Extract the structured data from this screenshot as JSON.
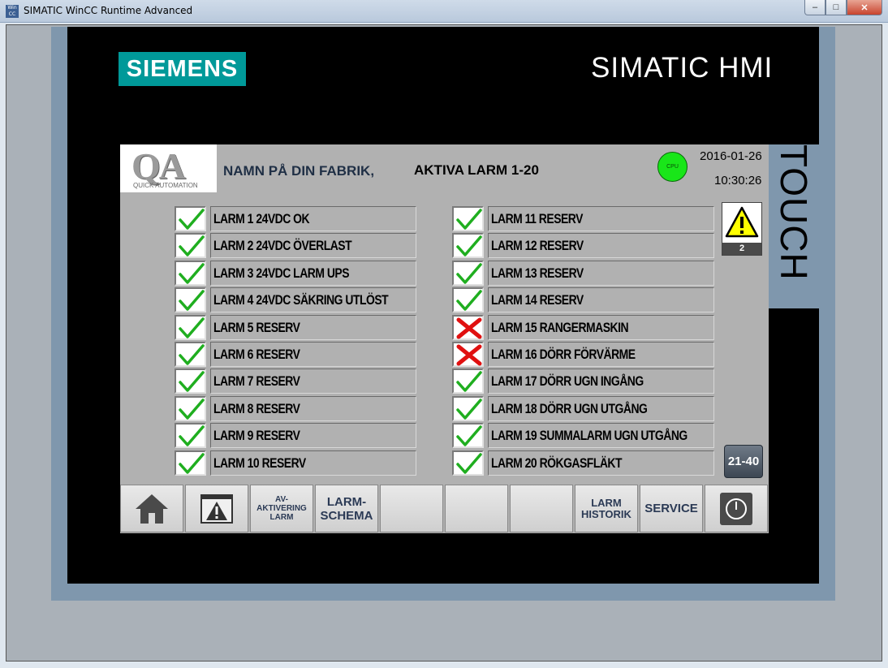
{
  "window": {
    "title": "SIMATIC WinCC Runtime Advanced",
    "icon_text": "Win CC",
    "minimize": "–",
    "maximize": "□",
    "close": "✕"
  },
  "panel": {
    "brand": "SIEMENS",
    "product": "SIMATIC HMI",
    "side_label": "TOUCH"
  },
  "header": {
    "logo_letters": "QA",
    "logo_sub": "QUICK AUTOMATION",
    "factory": "NAMN PÅ DIN FABRIK,",
    "title": "AKTIVA LARM 1-20",
    "cpu_label": "CPU",
    "date": "2016-01-26",
    "time": "10:30:26"
  },
  "alarms_left": [
    {
      "label": "LARM 1 24VDC OK",
      "ok": true
    },
    {
      "label": "LARM 2 24VDC ÖVERLAST",
      "ok": true
    },
    {
      "label": "LARM 3 24VDC LARM UPS",
      "ok": true
    },
    {
      "label": "LARM 4 24VDC SÄKRING UTLÖST",
      "ok": true
    },
    {
      "label": "LARM 5 RESERV",
      "ok": true
    },
    {
      "label": "LARM 6 RESERV",
      "ok": true
    },
    {
      "label": "LARM 7 RESERV",
      "ok": true
    },
    {
      "label": "LARM 8 RESERV",
      "ok": true
    },
    {
      "label": "LARM 9 RESERV",
      "ok": true
    },
    {
      "label": "LARM 10 RESERV",
      "ok": true
    }
  ],
  "alarms_right": [
    {
      "label": "LARM 11 RESERV",
      "ok": true
    },
    {
      "label": "LARM 12 RESERV",
      "ok": true
    },
    {
      "label": "LARM 13 RESERV",
      "ok": true
    },
    {
      "label": "LARM 14 RESERV",
      "ok": true
    },
    {
      "label": "LARM 15 RANGERMASKIN",
      "ok": false
    },
    {
      "label": "LARM 16 DÖRR FÖRVÄRME",
      "ok": false
    },
    {
      "label": "LARM 17 DÖRR UGN INGÅNG",
      "ok": true
    },
    {
      "label": "LARM 18 DÖRR UGN UTGÅNG",
      "ok": true
    },
    {
      "label": "LARM 19 SUMMALARM UGN UTGÅNG",
      "ok": true
    },
    {
      "label": "LARM 20 RÖKGASFLÄKT",
      "ok": true
    }
  ],
  "warning": {
    "count": "2"
  },
  "page_button": "21-40",
  "function_keys": {
    "deactivate": "AV-\nAKTIVERING\nLARM",
    "schema": "LARM-\nSCHEMA",
    "history": "LARM\nHISTORIK",
    "service": "SERVICE"
  },
  "colors": {
    "ok_check": "#1fae1f",
    "fault_x": "#e01010",
    "siemens_teal": "#009999",
    "cpu_led": "#19e619"
  }
}
